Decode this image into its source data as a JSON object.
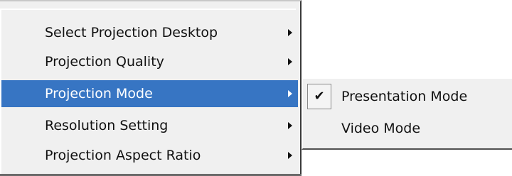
{
  "menu": {
    "items": [
      {
        "label": "Select Projection Desktop",
        "has_submenu": true,
        "active": false
      },
      {
        "label": "Projection Quality",
        "has_submenu": true,
        "active": false
      },
      {
        "label": "Projection Mode",
        "has_submenu": true,
        "active": true
      },
      {
        "label": "Resolution Setting",
        "has_submenu": true,
        "active": false
      },
      {
        "label": "Projection Aspect Ratio",
        "has_submenu": true,
        "active": false
      }
    ],
    "highlight_color": "#3775c3",
    "background_color": "#f0f0f0"
  },
  "submenu": {
    "items": [
      {
        "label": "Presentation Mode",
        "checked": true,
        "check_glyph": "✔",
        "icon": "checkmark-icon"
      },
      {
        "label": "Video Mode",
        "checked": false
      }
    ]
  }
}
